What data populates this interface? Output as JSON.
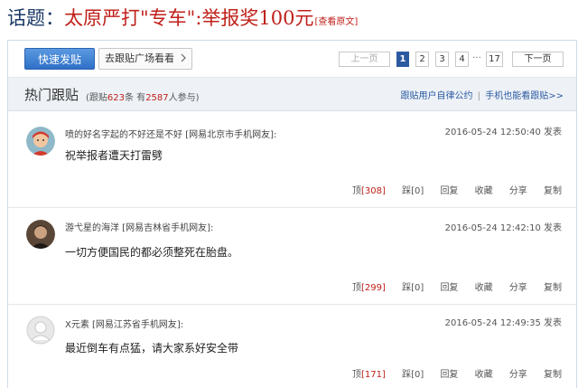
{
  "topic": {
    "prefix": "话题：",
    "title": "太原严打\"专车\":举报奖100元",
    "view_original": "[查看原文]"
  },
  "toolbar": {
    "post_button": "快速发贴",
    "square_button": "去跟贴广场看看",
    "square_icon": "chevron-right-icon"
  },
  "pager": {
    "prev": "上一页",
    "pages": [
      "1",
      "2",
      "3",
      "4"
    ],
    "ellipsis": "···",
    "last": "17",
    "next": "下一页",
    "current": "1"
  },
  "hot": {
    "title": "热门跟贴",
    "stats_prefix": "(跟贴",
    "posts_count": "623",
    "stats_mid": "条 有",
    "users_count": "2587",
    "stats_suffix": "人参与)",
    "policy_link": "跟贴用户自律公约",
    "separator": "|",
    "mobile_link": "手机也能看跟贴>>"
  },
  "comments": [
    {
      "user": "喷的好名字起的不好还是不好 [网易北京市手机网友]:",
      "time": "2016-05-24 12:50:40 发表",
      "text": "祝举报者遭天打雷劈",
      "up_label": "顶",
      "up_count": "[308]",
      "down": "踩[0]",
      "reply": "回复",
      "favorite": "收藏",
      "share": "分享",
      "copy": "复制"
    },
    {
      "user": "游弋星的海洋 [网易吉林省手机网友]:",
      "time": "2016-05-24 12:42:10 发表",
      "text": "一切方便国民的都必须整死在胎盘。",
      "up_label": "顶",
      "up_count": "[299]",
      "down": "踩[0]",
      "reply": "回复",
      "favorite": "收藏",
      "share": "分享",
      "copy": "复制"
    },
    {
      "user": "X元素 [网易江苏省手机网友]:",
      "time": "2016-05-24 12:49:35 发表",
      "text": "最近倒车有点猛，请大家系好安全带",
      "up_label": "顶",
      "up_count": "[171]",
      "down": "踩[0]",
      "reply": "回复",
      "favorite": "收藏",
      "share": "分享",
      "copy": "复制"
    }
  ],
  "colors": {
    "accent_red": "#c0201a",
    "link_blue": "#2b5aa1",
    "button_blue": "#3a7bd5"
  }
}
